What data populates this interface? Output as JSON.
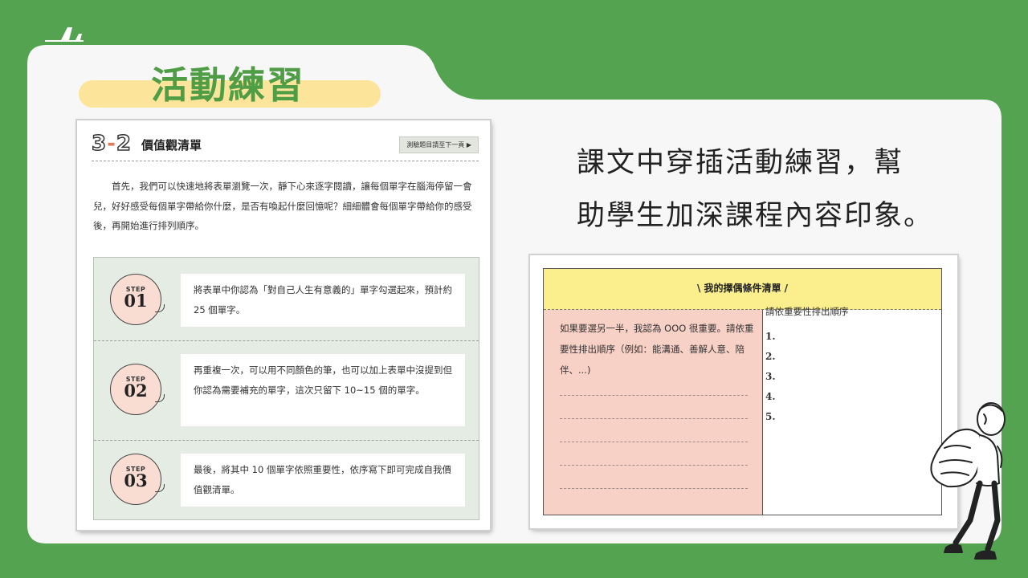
{
  "slide": {
    "title": "活動練習",
    "description_line1": "課文中穿插活動練習，幫",
    "description_line2": "助學生加深課程內容印象。"
  },
  "left_page": {
    "number": "3-2",
    "number_a": "3",
    "number_b": "2",
    "title": "價值觀清單",
    "badge": "測驗題目請至下一頁 ▶",
    "intro": "首先，我們可以快速地將表單瀏覽一次，靜下心來逐字閱讀，讓每個單字在腦海停留一會兒，好好感受每個單字帶給你什麼，是否有喚起什麼回憶呢？細細體會每個單字帶給你的感受後，再開始進行排列順序。",
    "steps": [
      {
        "label": "STEP",
        "num": "01",
        "text": "將表單中你認為「對自己人生有意義的」單字勾選起來，預計約 25 個單字。"
      },
      {
        "label": "STEP",
        "num": "02",
        "text": "再重複一次，可以用不同顏色的筆，也可以加上表單中沒提到但你認為需要補充的單字，這次只留下 10~15 個的單字。"
      },
      {
        "label": "STEP",
        "num": "03",
        "text": "最後，將其中 10 個單字依照重要性，依序寫下即可完成自我價值觀清單。"
      }
    ]
  },
  "right_page": {
    "header": "\\ 我的擇偶條件清單 /",
    "left_text": "如果要選另一半，我認為 OOO 很重要。請依重要性排出順序（例如：能溝通、善解人意、陪伴、...)",
    "right_title": "請依重要性排出順序",
    "list": [
      "1.",
      "2.",
      "3.",
      "4.",
      "5."
    ]
  },
  "colors": {
    "background": "#53a351",
    "title_green": "#4f9e45",
    "title_highlight": "#fce59a",
    "step_box": "#e4ece4",
    "step_circle": "#f9ddd2",
    "table_header": "#fbee8c",
    "table_left": "#f7d0c6"
  },
  "icons": [
    "airplane-icon",
    "student-backpack-illustration"
  ]
}
